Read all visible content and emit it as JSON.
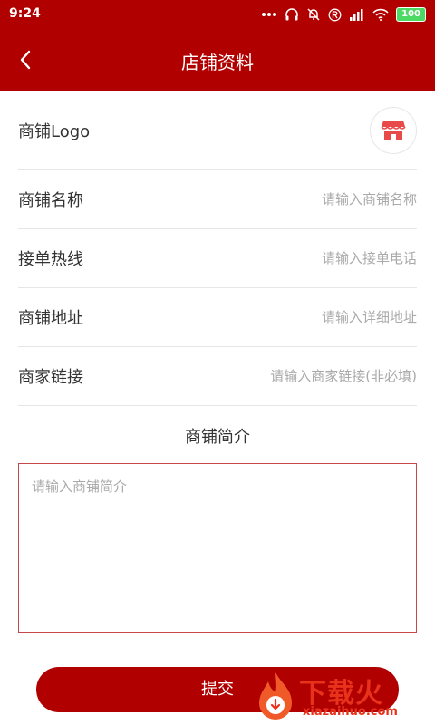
{
  "status": {
    "time": "9:24",
    "battery": "100"
  },
  "header": {
    "title": "店铺资料"
  },
  "form": {
    "logo_label": "商铺Logo",
    "name": {
      "label": "商铺名称",
      "value": "",
      "placeholder": "请输入商铺名称"
    },
    "hotline": {
      "label": "接单热线",
      "value": "",
      "placeholder": "请输入接单电话"
    },
    "address": {
      "label": "商铺地址",
      "value": "",
      "placeholder": "请输入详细地址"
    },
    "link": {
      "label": "商家链接",
      "value": "",
      "placeholder": "请输入商家链接(非必填)"
    }
  },
  "intro": {
    "title": "商铺简介",
    "value": "",
    "placeholder": "请输入商铺简介"
  },
  "submit_label": "提交",
  "watermark": {
    "brand": "下载火",
    "url": "xiazaihuo.com"
  },
  "colors": {
    "primary": "#b00000",
    "divider": "#e6e6e6",
    "placeholder": "#aaaaaa",
    "shop_icon": "#e84a4a",
    "battery": "#4cd964",
    "watermark": "#e8321c"
  },
  "icons": {
    "back": "chevron-left-icon",
    "logo": "shop-icon"
  }
}
